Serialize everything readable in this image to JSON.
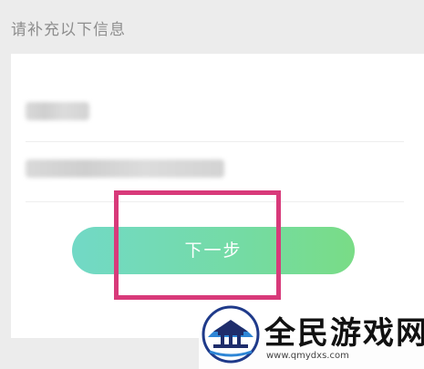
{
  "form": {
    "section_title": "请补充以下信息",
    "next_button_label": "下一步"
  },
  "watermark": {
    "site_name": "全民游戏网",
    "site_url": "www.qmydxs.com"
  },
  "colors": {
    "page_background": "#ececec",
    "card_background": "#ffffff",
    "button_gradient_start": "#72d9c6",
    "button_gradient_end": "#79dc86",
    "highlight_box": "#d83a7a"
  },
  "icons": {
    "watermark_logo": "temple-logo-icon"
  }
}
